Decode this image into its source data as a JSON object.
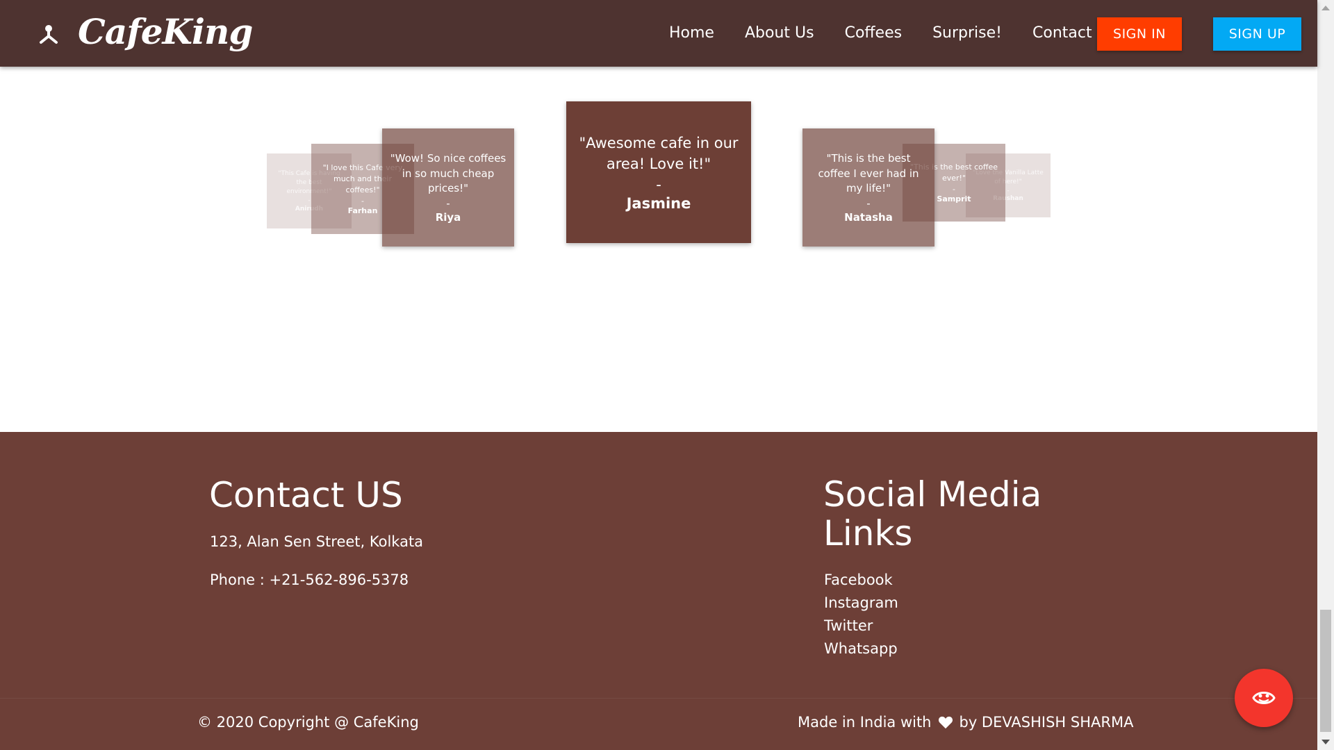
{
  "navbar": {
    "brand": "CafeKing",
    "links": [
      "Home",
      "About Us",
      "Coffees",
      "Surprise!",
      "Contact"
    ],
    "signin_label": "SIGN IN",
    "signup_label": "SIGN UP"
  },
  "testimonials": [
    {
      "quote": "\"This Cafe is having the best environment!\"",
      "dash": "-",
      "author": "Anirudh"
    },
    {
      "quote": "\"I love this Cafe very much and their coffees!\"",
      "dash": "-",
      "author": "Farhan"
    },
    {
      "quote": "\"Wow! So nice coffees in so much cheap prices!\"",
      "dash": "-",
      "author": "Riya"
    },
    {
      "quote": "\"Awesome cafe in our area! Love it!\"",
      "dash": "-",
      "author": "Jasmine"
    },
    {
      "quote": "\"This is the best coffee I ever had in my life!\"",
      "dash": "-",
      "author": "Natasha"
    },
    {
      "quote": "\"This is the best coffee ever!\"",
      "dash": "-",
      "author": "Samprit"
    },
    {
      "quote": "\"Love the Vanilla Latte of here!\"",
      "dash": "-",
      "author": "Raushan"
    }
  ],
  "footer": {
    "contact_title": "Contact US",
    "address": "123, Alan Sen Street, Kolkata",
    "phone": "Phone : +21-562-896-5378",
    "social_title": "Social Media Links",
    "social_links": [
      "Facebook",
      "Instagram",
      "Twitter",
      "Whatsapp"
    ],
    "copyright": "© 2020 Copyright @ CafeKing",
    "made_in_prefix": "Made in India with",
    "made_in_suffix": "by DEVASHISH SHARMA"
  },
  "colors": {
    "navbar_bg": "#4e3330",
    "card_bg": "#6d3f36",
    "footer_bg": "#6d3f37",
    "signin_bg": "#ff3d00",
    "signup_bg": "#03a9f4",
    "fab_bg": "#f3352c"
  },
  "icons": {
    "brand": "coffee-king-logo-icon",
    "heart": "heart-icon",
    "fab": "face-icon"
  }
}
